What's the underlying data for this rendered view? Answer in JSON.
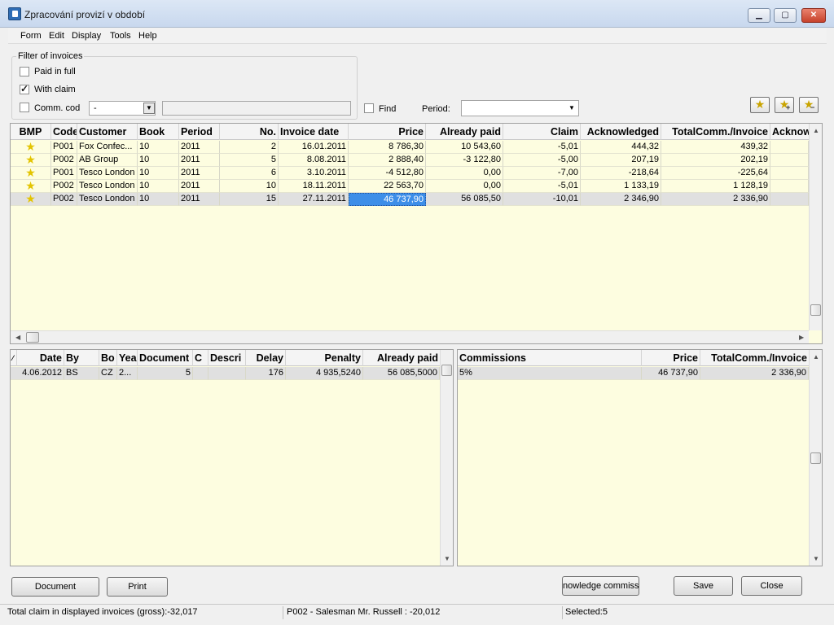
{
  "window": {
    "title": "Zpracování provizí v období"
  },
  "menu": [
    "Form",
    "Edit",
    "Display",
    "Tools",
    "Help"
  ],
  "filter": {
    "legend": "Filter of invoices",
    "paid_in_full": "Paid in full",
    "with_claim": "With claim",
    "comm_cod": "Comm. cod",
    "comm_cod_value": "-",
    "find": "Find",
    "period_label": "Period:",
    "period_value": ""
  },
  "invoices": {
    "columns": [
      "BMP",
      "Code",
      "Customer",
      "Book",
      "Period",
      "No.",
      "Invoice date",
      "Price",
      "Already paid",
      "Claim",
      "Acknowledged",
      "TotalComm./Invoice",
      "Acknow"
    ],
    "rows": [
      [
        "P001",
        "Fox Confec...",
        "10",
        "2011",
        "2",
        "16.01.2011",
        "8 786,30",
        "10 543,60",
        "-5,01",
        "444,32",
        "439,32"
      ],
      [
        "P002",
        "AB Group",
        "10",
        "2011",
        "5",
        "8.08.2011",
        "2 888,40",
        "-3 122,80",
        "-5,00",
        "207,19",
        "202,19"
      ],
      [
        "P001",
        "Tesco London",
        "10",
        "2011",
        "6",
        "3.10.2011",
        "-4 512,80",
        "0,00",
        "-7,00",
        "-218,64",
        "-225,64"
      ],
      [
        "P002",
        "Tesco London",
        "10",
        "2011",
        "10",
        "18.11.2011",
        "22 563,70",
        "0,00",
        "-5,01",
        "1 133,19",
        "1 128,19"
      ],
      [
        "P002",
        "Tesco London",
        "10",
        "2011",
        "15",
        "27.11.2011",
        "46 737,90",
        "56 085,50",
        "-10,01",
        "2 346,90",
        "2 336,90"
      ]
    ]
  },
  "payments": {
    "columns": [
      "Date",
      "By",
      "Bo",
      "Yea",
      "Document",
      "C",
      "Descri",
      "Delay",
      "Penalty",
      "Already paid"
    ],
    "rows": [
      [
        "4.06.2012",
        "BS",
        "CZ",
        "2...",
        "5",
        "",
        "",
        "176",
        "4 935,5240",
        "56 085,5000"
      ]
    ]
  },
  "commissions": {
    "columns": [
      "Commissions",
      "Price",
      "TotalComm./Invoice"
    ],
    "rows": [
      [
        "5%",
        "46 737,90",
        "2 336,90"
      ]
    ]
  },
  "buttons": {
    "document": "Document",
    "print": "Print",
    "acknowledge": "nowledge commissi",
    "save": "Save",
    "close": "Close"
  },
  "status": {
    "total_claim": "Total claim in displayed invoices (gross):-32,017",
    "salesman": "P002 - Salesman Mr. Russell : -20,012",
    "selected": "Selected:5"
  },
  "colors": {
    "grid_bg": "#fdfde0",
    "selection": "#3d8ee8",
    "star": "#e3c400"
  }
}
